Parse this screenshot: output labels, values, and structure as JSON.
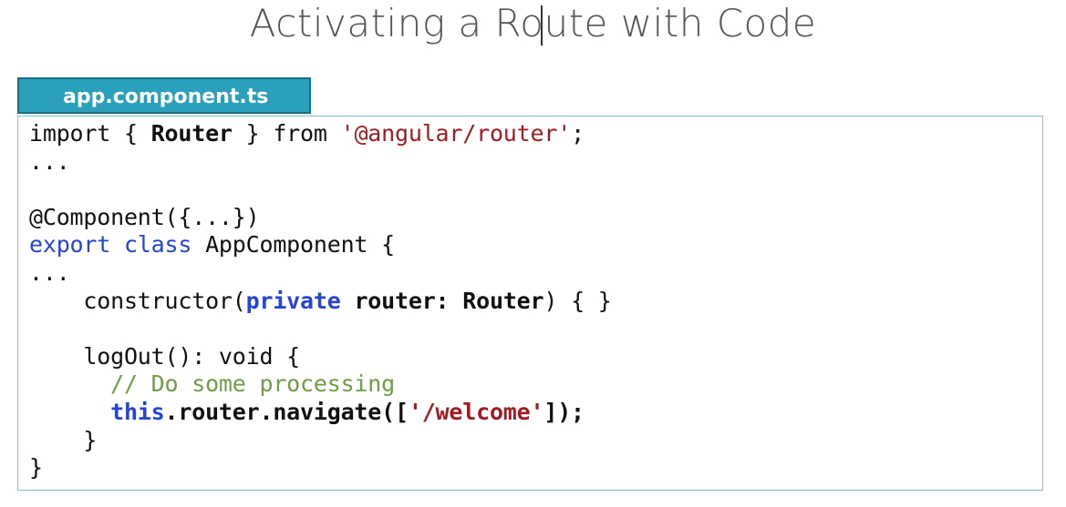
{
  "slide": {
    "title": "Activating a Route with Code"
  },
  "file_tab": {
    "label": "app.component.ts"
  },
  "code": {
    "lines": [
      [
        {
          "text": "import { ",
          "style": "plain"
        },
        {
          "text": "Router",
          "style": "bold"
        },
        {
          "text": " } from ",
          "style": "plain"
        },
        {
          "text": "'@angular/router'",
          "style": "str"
        },
        {
          "text": ";",
          "style": "plain"
        }
      ],
      [
        {
          "text": "...",
          "style": "plain"
        }
      ],
      [],
      [
        {
          "text": "@Component({...})",
          "style": "plain"
        }
      ],
      [
        {
          "text": "export class",
          "style": "kw"
        },
        {
          "text": " AppComponent {",
          "style": "plain"
        }
      ],
      [
        {
          "text": "...",
          "style": "plain"
        }
      ],
      [
        {
          "text": "    constructor(",
          "style": "plain"
        },
        {
          "text": "private",
          "style": "kw-bold"
        },
        {
          "text": " ",
          "style": "plain"
        },
        {
          "text": "router: Router",
          "style": "bold"
        },
        {
          "text": ") { }",
          "style": "plain"
        }
      ],
      [],
      [
        {
          "text": "    logOut(): void {",
          "style": "plain"
        }
      ],
      [
        {
          "text": "      ",
          "style": "plain"
        },
        {
          "text": "// Do some processing",
          "style": "comment"
        }
      ],
      [
        {
          "text": "      ",
          "style": "plain"
        },
        {
          "text": "this",
          "style": "this"
        },
        {
          "text": ".router.navigate([",
          "style": "bold"
        },
        {
          "text": "'/welcome'",
          "style": "str-bold"
        },
        {
          "text": "]);",
          "style": "bold"
        }
      ],
      [
        {
          "text": "    }",
          "style": "plain"
        }
      ],
      [
        {
          "text": "}",
          "style": "plain"
        }
      ]
    ]
  }
}
